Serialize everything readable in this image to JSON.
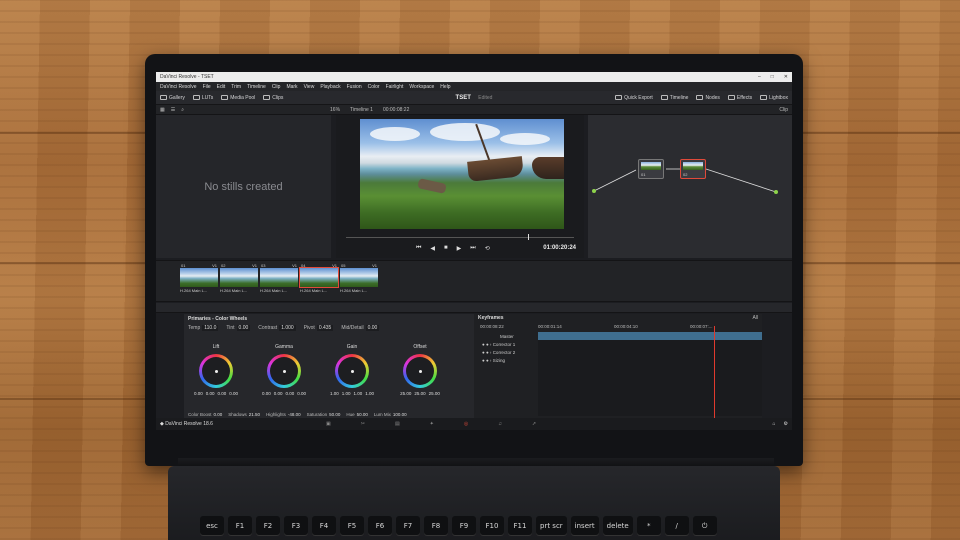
{
  "window": {
    "title": "DaVinci Resolve - TSET"
  },
  "menu": [
    "DaVinci Resolve",
    "File",
    "Edit",
    "Trim",
    "Timeline",
    "Clip",
    "Mark",
    "View",
    "Playback",
    "Fusion",
    "Color",
    "Fairlight",
    "Workspace",
    "Help"
  ],
  "toolbar": {
    "left": [
      "Gallery",
      "LUTs",
      "Media Pool",
      "Clips"
    ],
    "project": "TSET",
    "status": "Edited",
    "right": [
      "Quick Export",
      "Timeline",
      "Nodes",
      "Effects",
      "Lightbox"
    ]
  },
  "viewer_bar": {
    "zoom": "16%",
    "timeline": "Timeline 1",
    "timecode": "00:00:08:22",
    "mode": "Clip"
  },
  "gallery": {
    "empty_text": "No stills created"
  },
  "viewer": {
    "timecode": "01:00:20:24",
    "progress": 0.8
  },
  "nodes": [
    {
      "label": "01"
    },
    {
      "label": "02"
    }
  ],
  "clips": [
    {
      "num": "01",
      "track": "V1",
      "name": "H.264 Main L..."
    },
    {
      "num": "02",
      "track": "V1",
      "name": "H.264 Main L..."
    },
    {
      "num": "03",
      "track": "V1",
      "name": "H.264 Main L..."
    },
    {
      "num": "04",
      "track": "V1",
      "name": "H.264 Main L..."
    },
    {
      "num": "05",
      "track": "V1",
      "name": "H.264 Main L..."
    }
  ],
  "primaries": {
    "title": "Primaries - Color Wheels",
    "params": [
      {
        "label": "Temp",
        "value": "110.0"
      },
      {
        "label": "Tint",
        "value": "0.00"
      },
      {
        "label": "Contrast",
        "value": "1.000"
      },
      {
        "label": "Pivot",
        "value": "0.435"
      },
      {
        "label": "Mid/Detail",
        "value": "0.00"
      }
    ],
    "wheels": [
      {
        "name": "Lift",
        "values": [
          "0.00",
          "0.00",
          "0.00",
          "0.00"
        ]
      },
      {
        "name": "Gamma",
        "values": [
          "0.00",
          "0.00",
          "0.00",
          "0.00"
        ]
      },
      {
        "name": "Gain",
        "values": [
          "1.00",
          "1.00",
          "1.00",
          "1.00"
        ]
      },
      {
        "name": "Offset",
        "values": [
          "25.00",
          "25.00",
          "25.00"
        ]
      }
    ],
    "bottom": [
      {
        "label": "Color Boost",
        "value": "0.00"
      },
      {
        "label": "Shadows",
        "value": "21.50"
      },
      {
        "label": "Highlights",
        "value": "-48.00"
      },
      {
        "label": "Saturation",
        "value": "50.00"
      },
      {
        "label": "Hue",
        "value": "50.00"
      },
      {
        "label": "Lum Mix",
        "value": "100.00"
      }
    ]
  },
  "keyframes": {
    "title": "Keyframes",
    "filter": "All",
    "time_current": "00:00:08:22",
    "times": [
      "00:00:01:14",
      "00:00:04:10",
      "00:00:07:..."
    ],
    "rows": [
      "Master",
      "Corrector 1",
      "Corrector 2",
      "Sizing"
    ]
  },
  "statusbar": {
    "app": "DaVinci Resolve 18.6"
  },
  "keyboard": [
    "esc",
    "F1",
    "F2",
    "F3",
    "F4",
    "F5",
    "F6",
    "F7",
    "F8",
    "F9",
    "F10",
    "F11",
    "prt scr",
    "insert",
    "delete",
    "*",
    "/",
    "⏻"
  ]
}
